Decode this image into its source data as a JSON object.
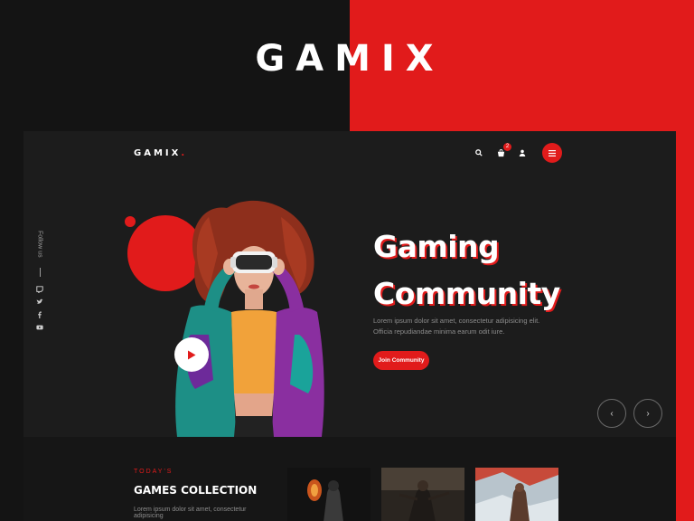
{
  "brand": {
    "big_title": "GAMIX",
    "nav_logo": "GAMIX",
    "nav_logo_dot": "."
  },
  "header": {
    "cart_count": "2"
  },
  "hero": {
    "follow_label": "Follow us",
    "headline_line1": "Gaming",
    "headline_line2": "Community",
    "description": "Lorem ipsum dolor sit amet, consectetur adipisicing elit. Officia repudiandae minima earum odit iure.",
    "cta_label": "Join Community",
    "prev_arrow": "‹",
    "next_arrow": "›"
  },
  "collection": {
    "eyebrow": "TODAY'S",
    "title": "GAMES COLLECTION",
    "description": "Lorem ipsum dolor sit amet, consectetur adipisicing"
  },
  "colors": {
    "accent": "#e11b1b",
    "background": "#141414",
    "panel": "#1c1c1c"
  }
}
